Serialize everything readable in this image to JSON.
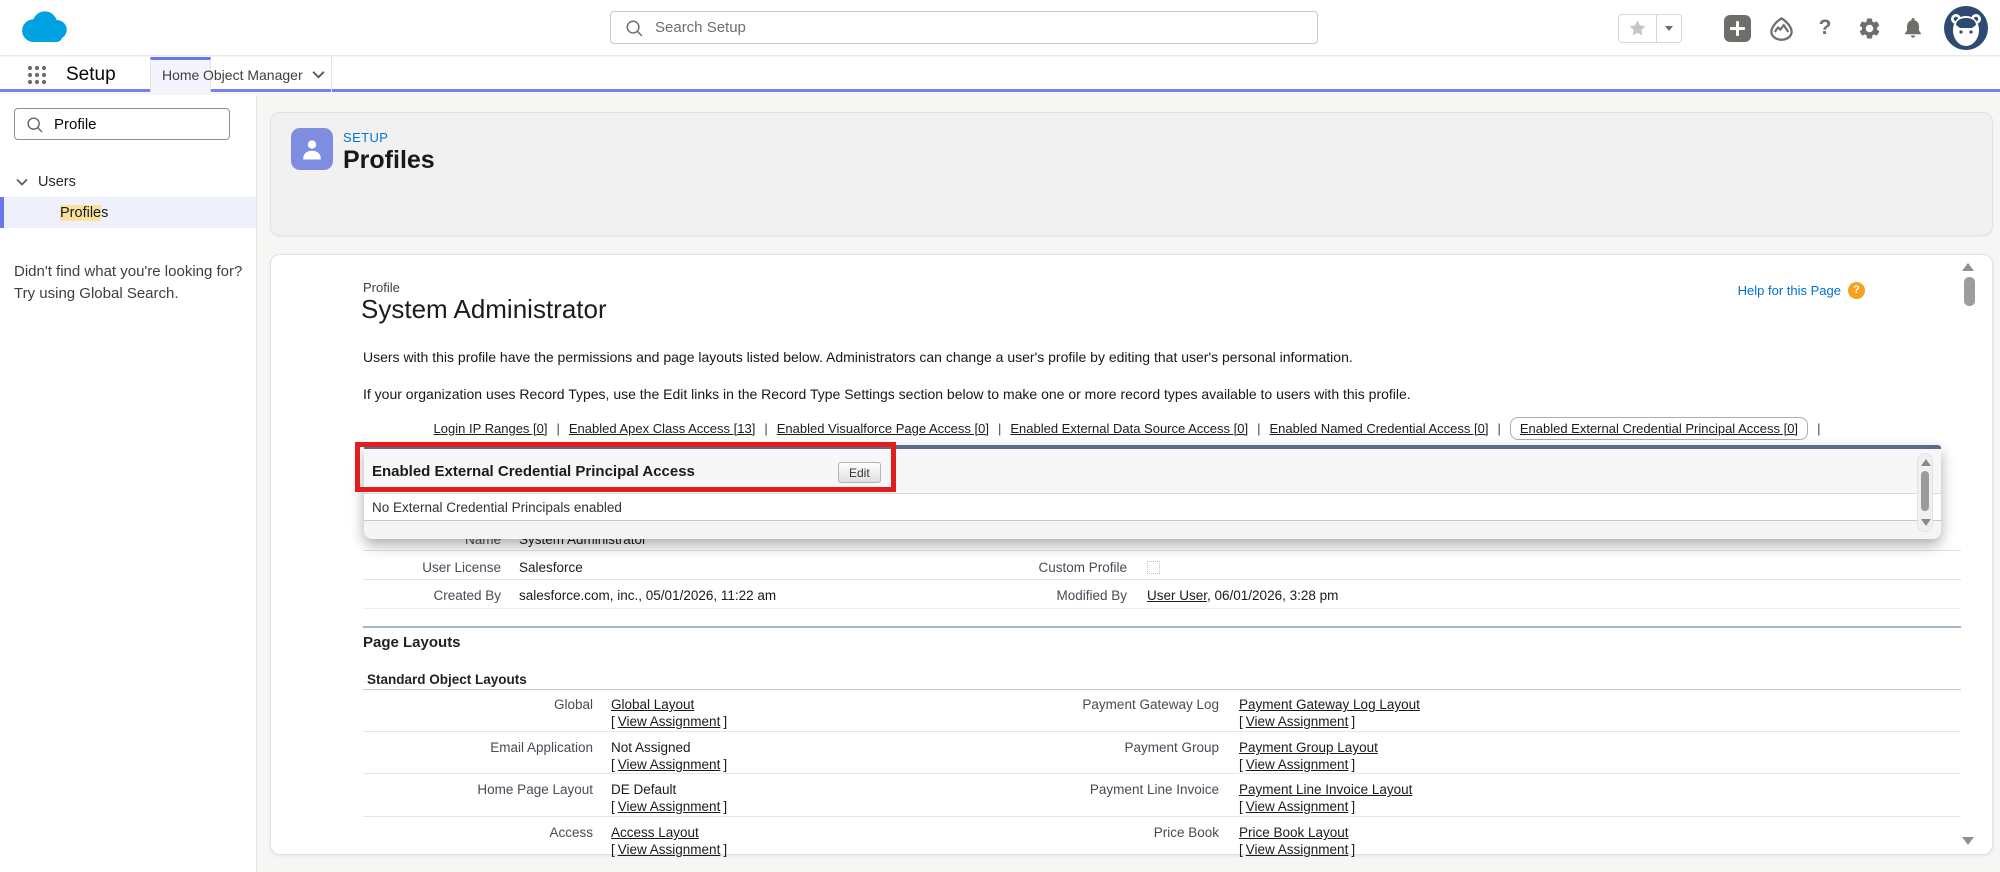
{
  "colors": {
    "accent_indigo": "#7580f2",
    "brand_blue": "#0176d3",
    "logo_blue": "#00A1E0",
    "setup_icon_violet": "#7f8de1",
    "annotation_red": "#e01e1e",
    "search_match_highlight": "#fbe19e",
    "avatar_bg": "#2d4b72",
    "help_badge_orange": "#f2a41d"
  },
  "global_header": {
    "search_placeholder": "Search Setup",
    "help_glyph": "?",
    "icons": [
      "favorites-star",
      "favorites-caret",
      "quick-create-plus",
      "trailhead",
      "help-question",
      "settings-gear",
      "notifications-bell",
      "user-avatar"
    ]
  },
  "nav": {
    "brand": "Setup",
    "tabs": [
      {
        "label": "Home",
        "active": true
      },
      {
        "label": "Object Manager",
        "active": false
      }
    ]
  },
  "sidebar": {
    "search_value": "Profile",
    "section": "Users",
    "selected_item": {
      "match": "Profile",
      "rest": "s"
    },
    "not_found": "Didn't find what you're looking for? Try using Global Search."
  },
  "page_header": {
    "eyebrow": "SETUP",
    "title": "Profiles"
  },
  "content": {
    "help_link": "Help for this Page",
    "help_badge": "?",
    "entity_label": "Profile",
    "title": "System Administrator",
    "description1": "Users with this profile have the permissions and page layouts listed below. Administrators can change a user's profile by editing that user's personal information.",
    "description2": "If your organization uses Record Types, use the Edit links in the Record Type Settings section below to make one or more record types available to users with this profile.",
    "links_separator": "|",
    "hover_links": [
      "Login IP Ranges [0]",
      "Enabled Apex Class Access [13]",
      "Enabled Visualforce Page Access [0]",
      "Enabled External Data Source Access [0]",
      "Enabled Named Credential Access [0]",
      "Enabled External Credential Principal Access [0]"
    ],
    "popup": {
      "title": "Enabled External Credential Principal Access",
      "edit_button": "Edit",
      "empty_message": "No External Credential Principals enabled"
    },
    "details": {
      "name_label": "Name",
      "name_value": "System Administrator",
      "user_license_label": "User License",
      "user_license_value": "Salesforce",
      "custom_profile_label": "Custom Profile",
      "custom_profile_checked": false,
      "created_by_label": "Created By",
      "created_by_value": "salesforce.com, inc., 05/01/2026, 11:22 am",
      "modified_by_label": "Modified By",
      "modified_by_link": "User User",
      "modified_by_rest": ", 06/01/2026, 3:28 pm"
    },
    "page_layouts": {
      "title": "Page Layouts",
      "subtitle": "Standard Object Layouts",
      "bracket_open": "[",
      "bracket_close": "]",
      "rows": [
        {
          "left": {
            "label": "Global",
            "value": "Global Layout",
            "is_link": true,
            "assignment": "View Assignment"
          },
          "right": {
            "label": "Payment Gateway Log",
            "value": "Payment Gateway Log Layout",
            "is_link": true,
            "assignment": "View Assignment"
          }
        },
        {
          "left": {
            "label": "Email Application",
            "value": "Not Assigned",
            "is_link": false,
            "assignment": "View Assignment"
          },
          "right": {
            "label": "Payment Group",
            "value": "Payment Group Layout",
            "is_link": true,
            "assignment": "View Assignment"
          }
        },
        {
          "left": {
            "label": "Home Page Layout",
            "value": "DE Default",
            "is_link": false,
            "assignment": "View Assignment"
          },
          "right": {
            "label": "Payment Line Invoice",
            "value": "Payment Line Invoice Layout",
            "is_link": true,
            "assignment": "View Assignment"
          }
        },
        {
          "left": {
            "label": "Access",
            "value": "Access Layout",
            "is_link": true,
            "assignment": "View Assignment"
          },
          "right": {
            "label": "Price Book",
            "value": "Price Book Layout",
            "is_link": true,
            "assignment": "View Assignment"
          }
        }
      ]
    }
  }
}
